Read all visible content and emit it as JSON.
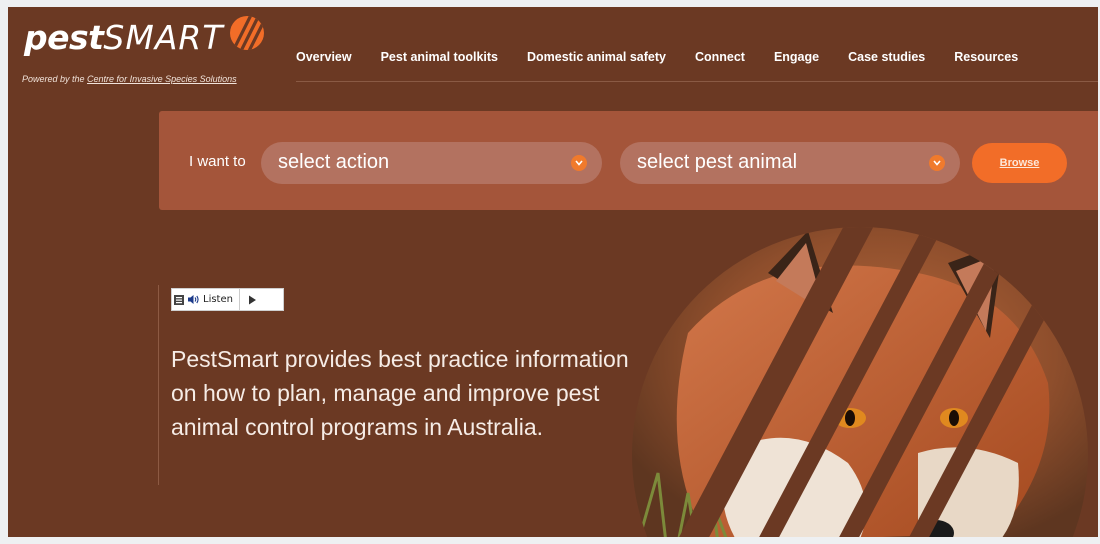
{
  "logo": {
    "pest": "pest",
    "smart": "SMART",
    "tagline_prefix": "Powered by the ",
    "tagline_link": "Centre for Invasive Species Solutions"
  },
  "nav": {
    "items": [
      "Overview",
      "Pest animal toolkits",
      "Domestic animal safety",
      "Connect",
      "Engage",
      "Case studies",
      "Resources"
    ]
  },
  "search": {
    "prefix": "I want to",
    "action_value": "select action",
    "animal_value": "select pest animal",
    "browse_label": "Browse"
  },
  "listen": {
    "label": "Listen"
  },
  "hero": {
    "text": "PestSmart provides best practice information on how to plan, manage and improve pest animal control programs in Australia."
  },
  "colors": {
    "background": "#6b3923",
    "panel": "#a4553a",
    "accent": "#f26d28"
  },
  "icons": [
    "logo-mark-icon",
    "chevron-down-icon",
    "speaker-icon",
    "play-icon",
    "menu-icon"
  ]
}
